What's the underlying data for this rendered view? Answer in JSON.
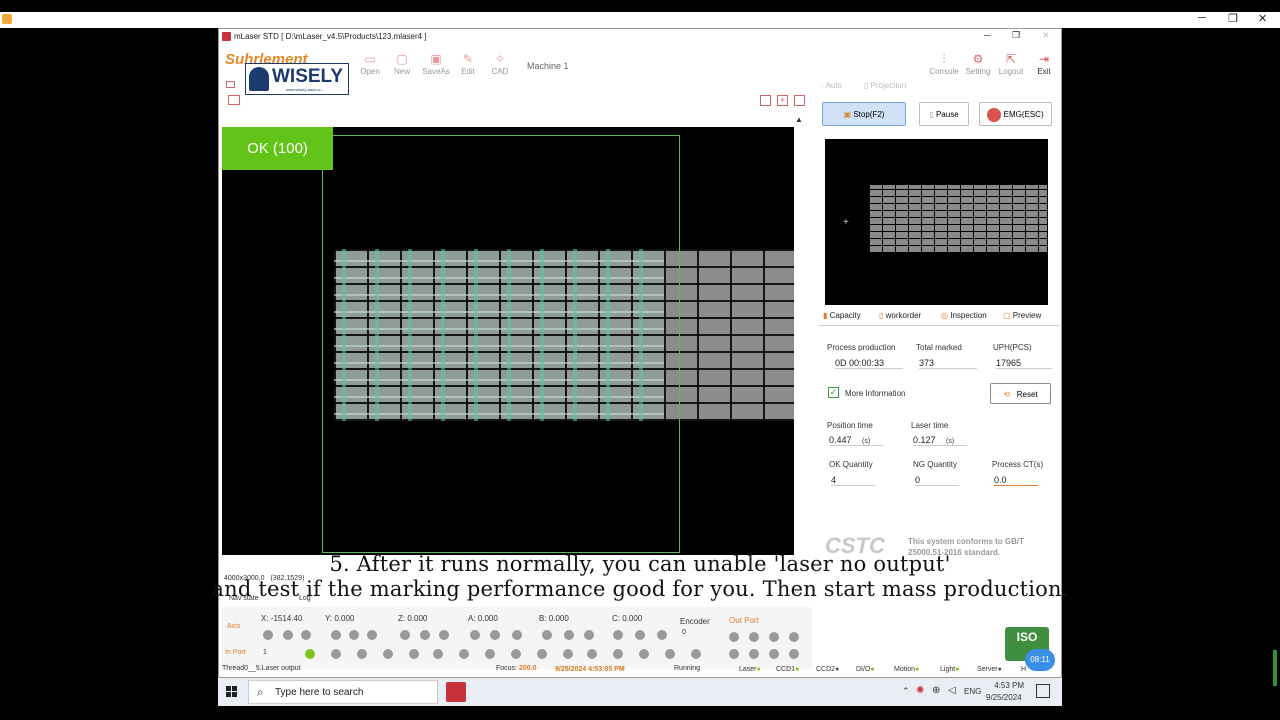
{
  "title_bar": {
    "text": "mLaser  STD  [ D:\\mLaser_v4.5\\Products\\123.mlaser4 ]",
    "min": "─",
    "max": "❐",
    "close": "✕"
  },
  "logo": {
    "brand": "WISELY",
    "url": "www.wisely-laser.cn",
    "behind": "Suhrlement"
  },
  "toolbar": {
    "open": "Open",
    "new": "New",
    "saveas": "SaveAs",
    "edit": "Edit",
    "cad": "CAD",
    "machine": "Machine 1",
    "console": "Console",
    "setting": "Setting",
    "logout": "Logout",
    "exit": "Exit"
  },
  "mode": {
    "auto": "Auto",
    "projection": "Projection"
  },
  "controls": {
    "stop": "Stop(F2)",
    "pause": "Pause",
    "emg": "EMG(ESC)"
  },
  "viewport": {
    "ok_badge": "OK (100)",
    "size": "4000x3000,0",
    "coords": "(382,1529)"
  },
  "tabs": {
    "capacity": "Capacity",
    "workorder": "workorder",
    "inspection": "Inspection",
    "preview": "Preview"
  },
  "stats": {
    "process_production_label": "Process production",
    "process_production": "0D 00:00:33",
    "total_marked_label": "Total marked",
    "total_marked": "373",
    "uph_label": "UPH(PCS)",
    "uph": "17965",
    "more_info": "More Information",
    "reset": "Reset",
    "position_time_label": "Position time",
    "position_time": "0.447",
    "unit_s": "(s)",
    "laser_time_label": "Laser time",
    "laser_time": "0.127",
    "ok_qty_label": "OK Quantity",
    "ok_qty": "4",
    "ng_qty_label": "NG Quantity",
    "ng_qty": "0",
    "ct_label": "Process CT(s)",
    "ct": "0.0"
  },
  "cstc": {
    "logo": "CSTC",
    "line1": "This system conforms to GB/T",
    "line2": "25000.51-2016 standard."
  },
  "bottom": {
    "nav_state": "Nav state",
    "log": "Log",
    "axis": "Axis",
    "x": "X: -1514.40",
    "y": "Y: 0.000",
    "z": "Z: 0.000",
    "a": "A: 0.000",
    "b": "B: 0.000",
    "c": "C: 0.000",
    "encoder": "Encoder",
    "encoder_val": "0",
    "out_port": "Out Port",
    "in_port": "In Port",
    "in_port_val": "1"
  },
  "status": {
    "thread": "Thread0__5.Laser output",
    "focus_label": "Focus:",
    "focus": "200.0",
    "datetime": "9/25/2024 4:53:05 PM",
    "running": "Running",
    "laser": "Laser",
    "ccd1": "CCD1",
    "ccd2": "CCD2",
    "dio": "DI/O",
    "motion": "Motion",
    "light": "Light",
    "server": "Server",
    "hc": "H"
  },
  "iso": "ISO",
  "bubble": "08:11",
  "subtitle": {
    "line1": "5. After it runs normally, you can unable 'laser no output'",
    "line2": "and test if the marking performance good for you. Then start mass production."
  },
  "taskbar": {
    "search": "Type here to search",
    "lang": "ENG",
    "time": "4:53 PM",
    "date": "9/25/2024"
  },
  "colors": {
    "ok_green": "#62c419",
    "accent_red": "#d9534f",
    "stop_blue": "#cfe0f7"
  }
}
